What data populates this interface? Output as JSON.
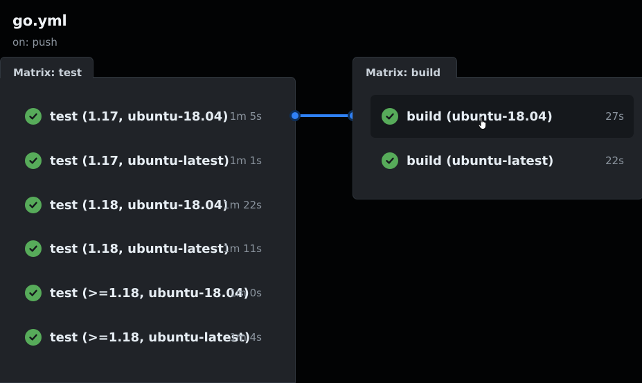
{
  "workflow": {
    "title": "go.yml",
    "trigger": "on: push"
  },
  "groups": {
    "test": {
      "label": "Matrix: test",
      "jobs": [
        {
          "name": "test (1.17, ubuntu-18.04)",
          "duration": "1m 5s",
          "status": "success"
        },
        {
          "name": "test (1.17, ubuntu-latest)",
          "duration": "1m 1s",
          "status": "success"
        },
        {
          "name": "test (1.18, ubuntu-18.04)",
          "duration": "1m 22s",
          "status": "success"
        },
        {
          "name": "test (1.18, ubuntu-latest)",
          "duration": "1m 11s",
          "status": "success"
        },
        {
          "name": "test (>=1.18, ubuntu-18.04)",
          "duration": "1m 0s",
          "status": "success"
        },
        {
          "name": "test (>=1.18, ubuntu-latest)",
          "duration": "1m 4s",
          "status": "success"
        }
      ]
    },
    "build": {
      "label": "Matrix: build",
      "jobs": [
        {
          "name": "build (ubuntu-18.04)",
          "duration": "27s",
          "status": "success"
        },
        {
          "name": "build (ubuntu-latest)",
          "duration": "22s",
          "status": "success"
        }
      ]
    }
  },
  "colors": {
    "background": "#020304",
    "panel": "#202328",
    "success": "#57ab5a",
    "connector": "#2f81f7"
  },
  "icons": {
    "status": "check-circle-icon",
    "cursor": "pointer-hand-icon"
  }
}
